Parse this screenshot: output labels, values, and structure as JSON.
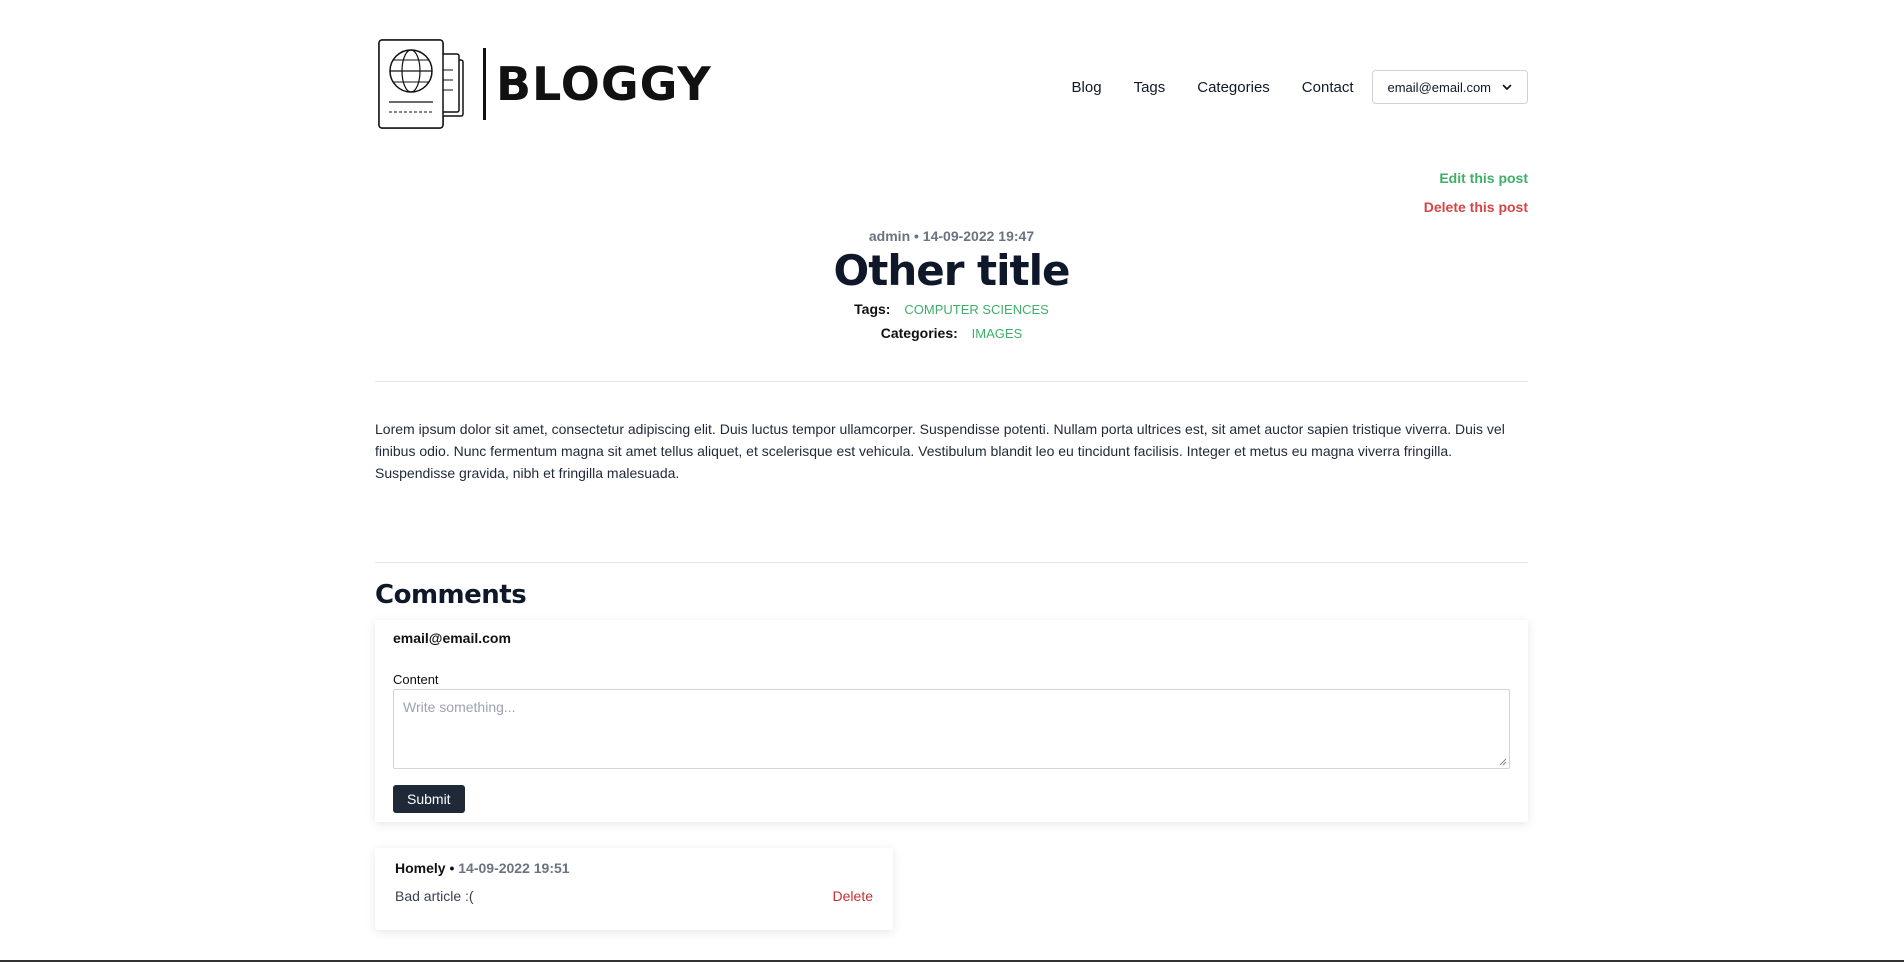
{
  "brand": {
    "name": "BLOGGY"
  },
  "nav": {
    "items": [
      "Blog",
      "Tags",
      "Categories",
      "Contact"
    ],
    "user_email": "email@email.com"
  },
  "post": {
    "edit_label": "Edit this post",
    "delete_label": "Delete this post",
    "author": "admin",
    "date": "14-09-2022 19:47",
    "meta": "admin • 14-09-2022 19:47",
    "title": "Other title",
    "tags_label": "Tags:",
    "tags": [
      "COMPUTER SCIENCES"
    ],
    "categories_label": "Categories:",
    "categories": [
      "IMAGES"
    ],
    "body": "Lorem ipsum dolor sit amet, consectetur adipiscing elit. Duis luctus tempor ullamcorper. Suspendisse potenti. Nullam porta ultrices est, sit amet auctor sapien tristique viverra. Duis vel finibus odio. Nunc fermentum magna sit amet tellus aliquet, et scelerisque est vehicula. Vestibulum blandit leo eu tincidunt facilisis. Integer et metus eu magna viverra fringilla. Suspendisse gravida, nibh et fringilla malesuada."
  },
  "comments": {
    "title": "Comments",
    "form": {
      "user": "email@email.com",
      "content_label": "Content",
      "placeholder": "Write something...",
      "submit_label": "Submit"
    },
    "items": [
      {
        "author": "Homely",
        "separator": "•",
        "date": "14-09-2022 19:51",
        "text": "Bad article :(",
        "delete_label": "Delete"
      }
    ]
  },
  "colors": {
    "accent_green": "#3fae6a",
    "danger_red": "#d64545",
    "dark_button": "#1f2937"
  }
}
